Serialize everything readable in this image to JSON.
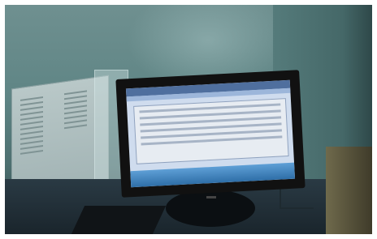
{
  "scene": {
    "kind": "photo",
    "border_color": "#000000"
  },
  "monitor": {
    "brand_text": "",
    "screen_colors": {
      "title_bar": "#4f6f9e",
      "body": "#cfdcee",
      "taskbar": "#2e6ea7"
    }
  }
}
